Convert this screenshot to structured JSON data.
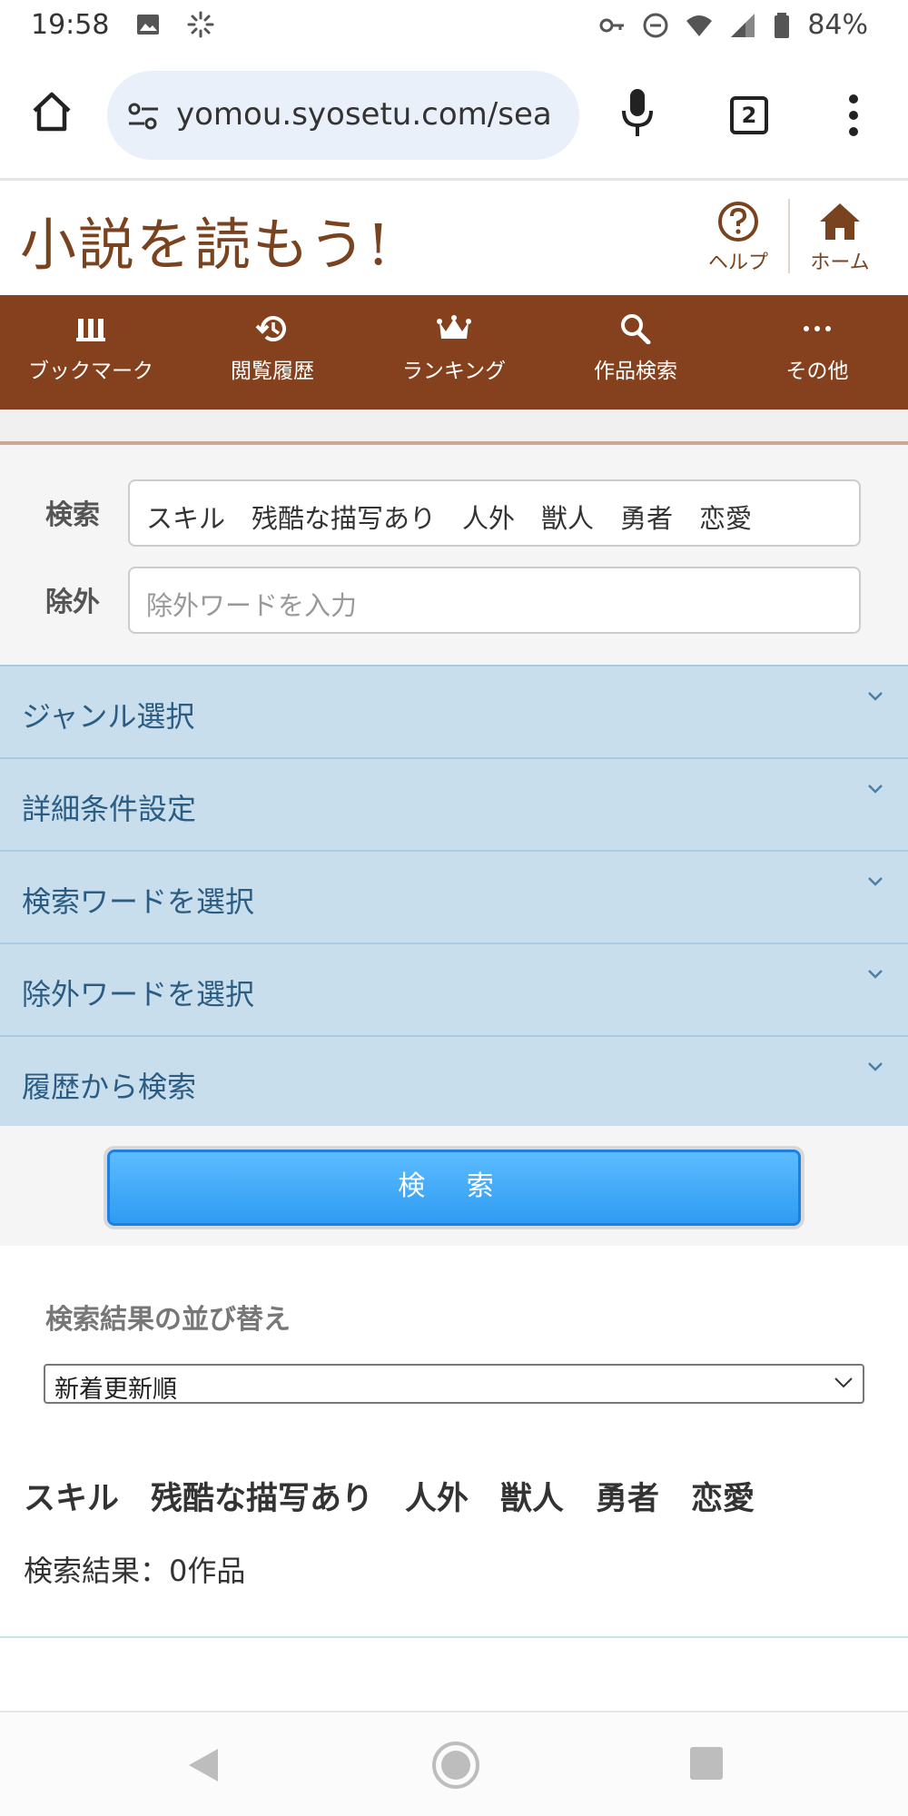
{
  "status_bar": {
    "time": "19:58",
    "battery": "84%"
  },
  "browser": {
    "url": "yomou.syosetu.com/sea",
    "tab_count": "2"
  },
  "site": {
    "logo": "小説を読もう!",
    "help_label": "ヘルプ",
    "home_label": "ホーム",
    "brand_color": "#85401d"
  },
  "nav": {
    "items": [
      {
        "label": "ブックマーク",
        "icon": "bookmark-icon"
      },
      {
        "label": "閲覧履歴",
        "icon": "history-icon"
      },
      {
        "label": "ランキング",
        "icon": "crown-icon"
      },
      {
        "label": "作品検索",
        "icon": "search-icon"
      },
      {
        "label": "その他",
        "icon": "more-icon"
      }
    ]
  },
  "search": {
    "keyword_label": "検索",
    "keyword_value": "スキル　残酷な描写あり　人外　獣人　勇者　恋愛",
    "exclude_label": "除外",
    "exclude_placeholder": "除外ワードを入力"
  },
  "accordion": {
    "items": [
      "ジャンル選択",
      "詳細条件設定",
      "検索ワードを選択",
      "除外ワードを選択",
      "履歴から検索"
    ]
  },
  "search_button": "検 索",
  "results": {
    "sort_title": "検索結果の並び替え",
    "sort_selected": "新着更新順",
    "query_display": "スキル　残酷な描写あり　人外　獣人　勇者　恋愛",
    "count_text": "検索結果：0作品"
  }
}
